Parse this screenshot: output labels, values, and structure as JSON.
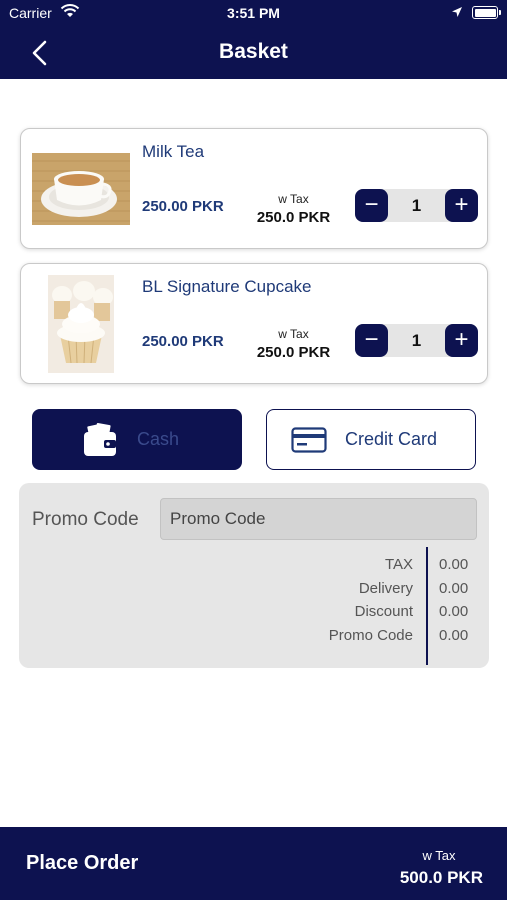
{
  "status_bar": {
    "carrier": "Carrier",
    "time": "3:51 PM"
  },
  "header": {
    "title": "Basket"
  },
  "items": [
    {
      "name": "Milk Tea",
      "price": "250.00 PKR",
      "wtax_label": "w Tax",
      "wtax_value": "250.0 PKR",
      "quantity": "1",
      "minus": "−",
      "plus": "+"
    },
    {
      "name": "BL Signature Cupcake",
      "price": "250.00 PKR",
      "wtax_label": "w Tax",
      "wtax_value": "250.0 PKR",
      "quantity": "1",
      "minus": "−",
      "plus": "+"
    }
  ],
  "payment": {
    "cash_label": "Cash",
    "card_label": "Credit Card",
    "selected": "Cash"
  },
  "promo": {
    "label": "Promo Code",
    "placeholder": "Promo Code",
    "value": ""
  },
  "summary_rows": [
    {
      "label": "TAX",
      "value": "0.00"
    },
    {
      "label": "Delivery",
      "value": "0.00"
    },
    {
      "label": "Discount",
      "value": "0.00"
    },
    {
      "label": "Promo Code",
      "value": "0.00"
    }
  ],
  "footer": {
    "place_order_label": "Place Order",
    "total_label": "w Tax",
    "total_value": "500.0 PKR"
  },
  "colors": {
    "primary": "#0d1250",
    "accent_text": "#1f3a78",
    "panel": "#e6e6e6"
  }
}
